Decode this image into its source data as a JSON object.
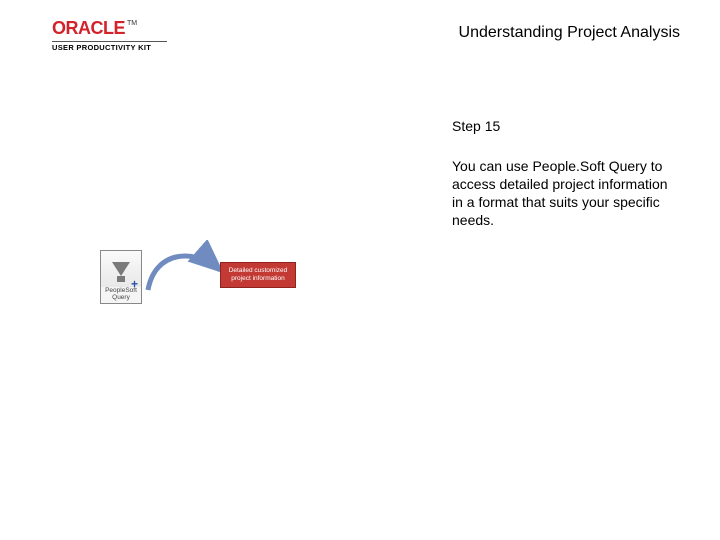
{
  "logo": {
    "brand": "ORACLE",
    "tm": "TM",
    "product_line": "USER PRODUCTIVITY KIT"
  },
  "page_title": "Understanding Project Analysis",
  "step": {
    "label": "Step 15",
    "body": "You can use People.Soft Query to access detailed project information in a format that suits your specific needs."
  },
  "diagram": {
    "icon_caption": "PeopleSoft Query",
    "callout": "Detailed customized project information"
  }
}
